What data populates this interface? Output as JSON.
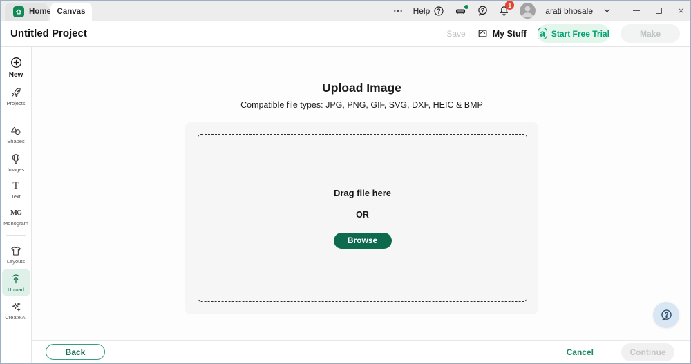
{
  "topbar": {
    "tabs": [
      {
        "label": "Home"
      },
      {
        "label": "Canvas"
      }
    ],
    "help_label": "Help",
    "notification_count": "1",
    "user_name": "arati bhosale"
  },
  "header": {
    "title": "Untitled Project",
    "save_label": "Save",
    "my_stuff_label": "My Stuff",
    "trial_label": "Start Free Trial",
    "make_label": "Make"
  },
  "sidebar": {
    "items": [
      {
        "label": "New",
        "icon": "plus-circle-icon"
      },
      {
        "label": "Projects",
        "icon": "rocket-icon"
      },
      {
        "label": "Shapes",
        "icon": "shapes-icon"
      },
      {
        "label": "Images",
        "icon": "balloon-icon"
      },
      {
        "label": "Text",
        "icon": "letter-t-icon"
      },
      {
        "label": "Monogram",
        "icon": "monogram-icon"
      },
      {
        "label": "Layouts",
        "icon": "tshirt-icon"
      },
      {
        "label": "Upload",
        "icon": "upload-arrow-icon",
        "active": true
      },
      {
        "label": "Create AI",
        "icon": "sparkles-icon"
      }
    ]
  },
  "main": {
    "title": "Upload Image",
    "subtitle": "Compatible file types:  JPG, PNG, GIF, SVG, DXF, HEIC & BMP",
    "dropzone": {
      "drag_label": "Drag file here",
      "or_label": "OR",
      "browse_label": "Browse"
    }
  },
  "footer": {
    "back_label": "Back",
    "cancel_label": "Cancel",
    "continue_label": "Continue"
  },
  "glyphs": {
    "question": "?",
    "access": "a",
    "text_icon": "T",
    "monogram_icon": "MG"
  },
  "colors": {
    "brand_green": "#0d6a4c",
    "mint_highlight": "#def0e7",
    "trial_green": "#00a471",
    "trial_bg": "#e4f5ec",
    "badge_red": "#e8432e",
    "help_fab_bg": "#d9e6f4",
    "help_fab_icon": "#33536e"
  }
}
